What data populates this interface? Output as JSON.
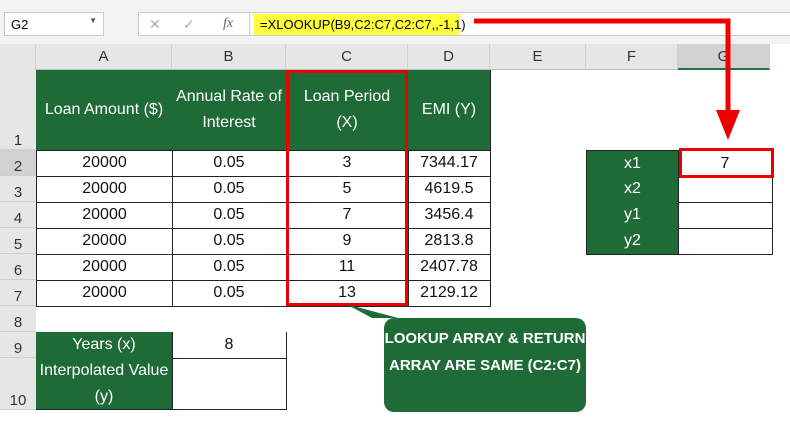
{
  "name_box": "G2",
  "formula_buttons": {
    "cancel": "✕",
    "enter": "✓",
    "fx": "fx"
  },
  "formula": "=XLOOKUP(B9,C2:C7,C2:C7,,-1,1)",
  "columns": [
    "A",
    "B",
    "C",
    "D",
    "E",
    "F",
    "G"
  ],
  "rows": [
    "1",
    "2",
    "3",
    "4",
    "5",
    "6",
    "7",
    "8",
    "9",
    "10"
  ],
  "headers": {
    "a": "Loan Amount ($)",
    "b": "Annual Rate of Interest",
    "c": "Loan Period (X)",
    "d": "EMI (Y)"
  },
  "table": [
    [
      "20000",
      "0.05",
      "3",
      "7344.17"
    ],
    [
      "20000",
      "0.05",
      "5",
      "4619.5"
    ],
    [
      "20000",
      "0.05",
      "7",
      "3456.4"
    ],
    [
      "20000",
      "0.05",
      "9",
      "2813.8"
    ],
    [
      "20000",
      "0.05",
      "11",
      "2407.78"
    ],
    [
      "20000",
      "0.05",
      "13",
      "2129.12"
    ]
  ],
  "years_label": "Years (x)",
  "years_value": "8",
  "interp_label": "Interpolated Value (y)",
  "interp_value": "",
  "side": [
    {
      "label": "x1",
      "value": "7"
    },
    {
      "label": "x2",
      "value": ""
    },
    {
      "label": "y1",
      "value": ""
    },
    {
      "label": "y2",
      "value": ""
    }
  ],
  "callout": "LOOKUP ARRAY & RETURN ARRAY ARE SAME (C2:C7)",
  "colors": {
    "green": "#1f6b38",
    "red": "#e00000",
    "highlight": "#ffff3b"
  }
}
